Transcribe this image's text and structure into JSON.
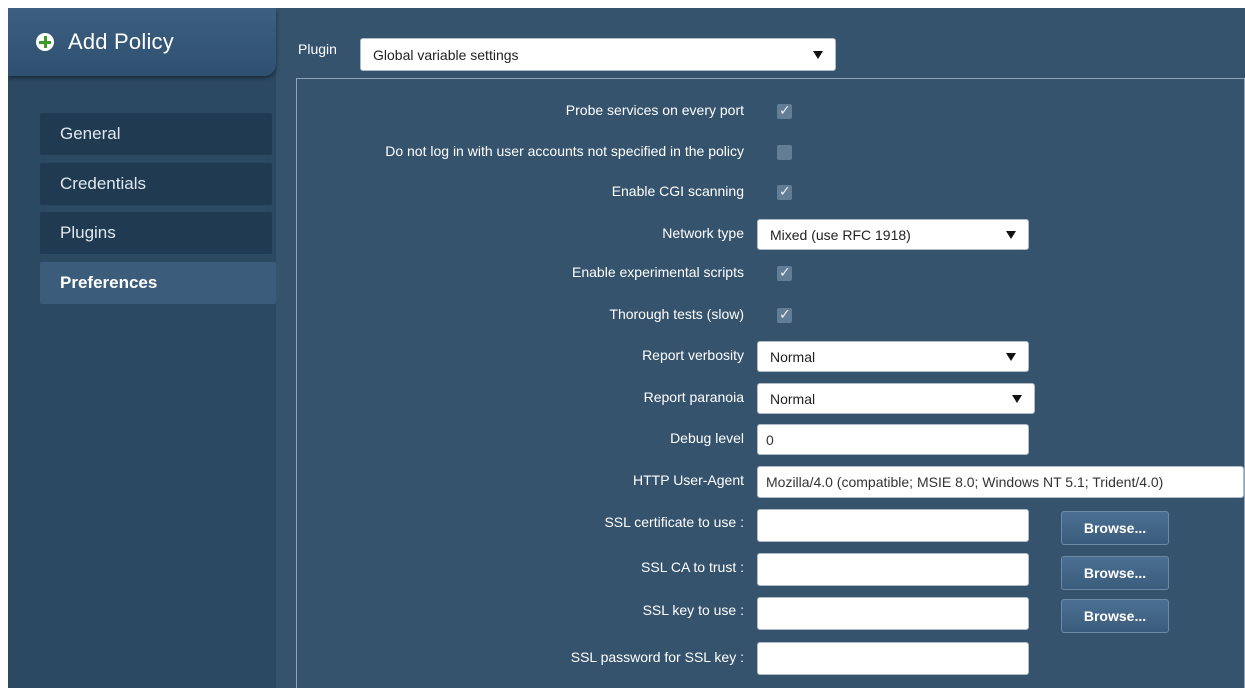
{
  "header": {
    "title": "Add Policy"
  },
  "sidebar": {
    "items": [
      {
        "label": "General"
      },
      {
        "label": "Credentials"
      },
      {
        "label": "Plugins"
      },
      {
        "label": "Preferences"
      }
    ]
  },
  "plugin": {
    "label": "Plugin",
    "selected": "Global variable settings"
  },
  "settings": {
    "probe_services": {
      "label": "Probe services on every port",
      "checked": true
    },
    "no_login": {
      "label": "Do not log in with user accounts not specified in the policy",
      "checked": false
    },
    "cgi_scanning": {
      "label": "Enable CGI scanning",
      "checked": true
    },
    "network_type": {
      "label": "Network type",
      "selected": "Mixed (use RFC 1918)"
    },
    "experimental": {
      "label": "Enable experimental scripts",
      "checked": true
    },
    "thorough": {
      "label": "Thorough tests (slow)",
      "checked": true
    },
    "verbosity": {
      "label": "Report verbosity",
      "selected": "Normal"
    },
    "paranoia": {
      "label": "Report paranoia",
      "selected": "Normal"
    },
    "debug": {
      "label": "Debug level",
      "value": "0"
    },
    "user_agent": {
      "label": "HTTP User-Agent",
      "value": "Mozilla/4.0 (compatible; MSIE 8.0; Windows NT 5.1; Trident/4.0)"
    },
    "ssl_cert": {
      "label": "SSL certificate to use :",
      "value": "",
      "browse": "Browse..."
    },
    "ssl_ca": {
      "label": "SSL CA to trust :",
      "value": "",
      "browse": "Browse..."
    },
    "ssl_key": {
      "label": "SSL key to use :",
      "value": "",
      "browse": "Browse..."
    },
    "ssl_password": {
      "label": "SSL password for SSL key :",
      "value": ""
    }
  },
  "icons": {
    "add": "plus-circle-icon",
    "check": "checkmark-icon",
    "dropdown": "triangle-down-icon"
  },
  "colors": {
    "background": "#35536d",
    "sidebar": "#2c4962",
    "nav_item": "#203a51",
    "active_nav": "#3b5d7b"
  }
}
